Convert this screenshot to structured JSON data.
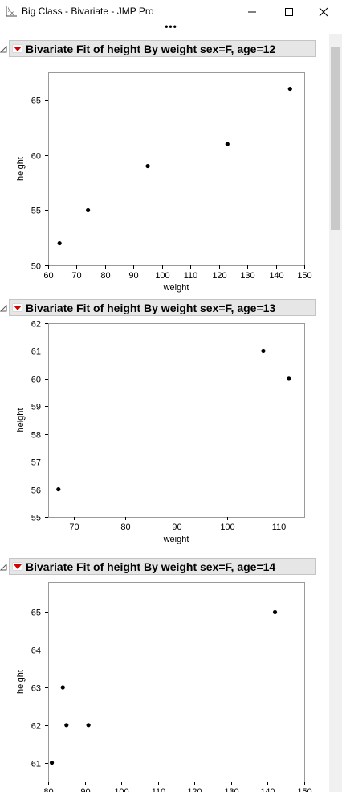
{
  "window": {
    "title": "Big Class - Bivariate - JMP Pro",
    "app_icon": "jmp-yx-icon",
    "controls": [
      "minimize-icon",
      "maximize-icon",
      "close-icon"
    ]
  },
  "toolbar": {
    "overflow_label": "•••"
  },
  "reports": [
    {
      "title": "Bivariate Fit of height By weight sex=F, age=12",
      "chart_data": {
        "type": "scatter",
        "xlabel": "weight",
        "ylabel": "height",
        "xlim": [
          60,
          150
        ],
        "ylim": [
          50,
          67.5
        ],
        "xticks": [
          60,
          70,
          80,
          90,
          100,
          110,
          120,
          130,
          140,
          150
        ],
        "yticks": [
          50,
          55,
          60,
          65
        ],
        "x": [
          64,
          74,
          95,
          123,
          145
        ],
        "y": [
          52,
          55,
          59,
          61,
          66
        ]
      }
    },
    {
      "title": "Bivariate Fit of height By weight sex=F, age=13",
      "chart_data": {
        "type": "scatter",
        "xlabel": "weight",
        "ylabel": "height",
        "xlim": [
          65,
          115
        ],
        "ylim": [
          55,
          62
        ],
        "xticks": [
          70,
          80,
          90,
          100,
          110
        ],
        "yticks": [
          55,
          56,
          57,
          58,
          59,
          60,
          61,
          62
        ],
        "x": [
          67,
          107,
          112
        ],
        "y": [
          56,
          61,
          60
        ]
      }
    },
    {
      "title": "Bivariate Fit of height By weight sex=F, age=14",
      "chart_data": {
        "type": "scatter",
        "xlabel": "",
        "ylabel": "height",
        "xlim": [
          80,
          150
        ],
        "ylim": [
          60.5,
          65.8
        ],
        "xticks": [
          80,
          90,
          100,
          110,
          120,
          130,
          140,
          150
        ],
        "yticks": [
          61,
          62,
          63,
          64,
          65
        ],
        "x": [
          81,
          84,
          85,
          91,
          142
        ],
        "y": [
          61,
          63,
          62,
          62,
          65
        ]
      }
    }
  ]
}
